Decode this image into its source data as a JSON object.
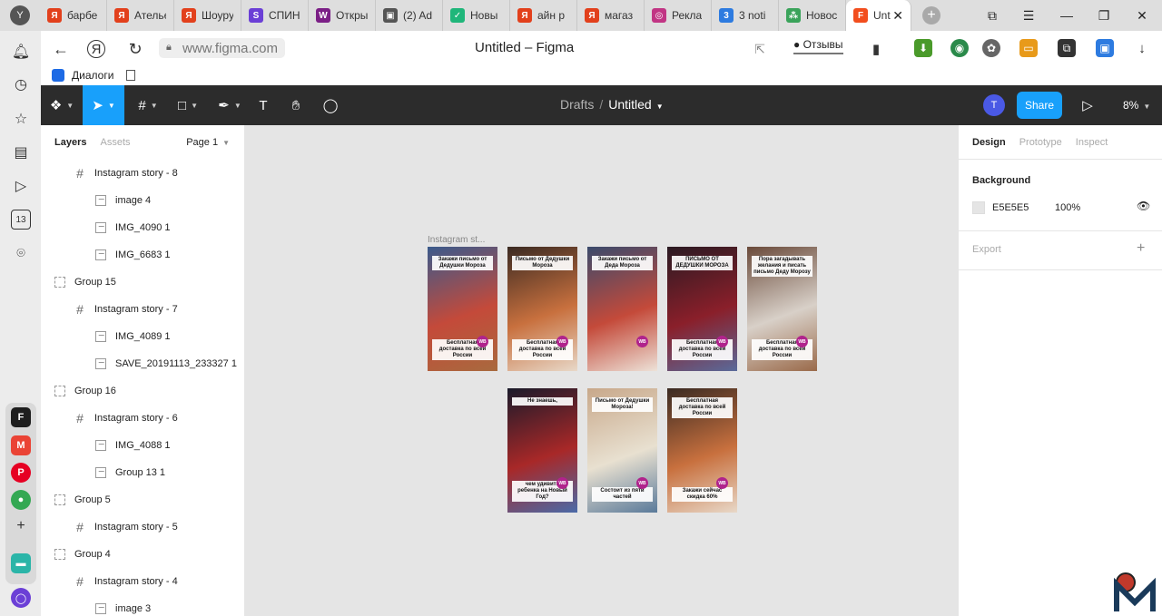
{
  "browser": {
    "logo": "Y",
    "tabs": [
      {
        "label": "барбе",
        "icon_color": "#e2401c",
        "icon_glyph": "Я"
      },
      {
        "label": "Ателье",
        "icon_color": "#e2401c",
        "icon_glyph": "Я"
      },
      {
        "label": "Шоурум",
        "icon_color": "#e2401c",
        "icon_glyph": "Я"
      },
      {
        "label": "СПИН",
        "icon_color": "#6b3fd6",
        "icon_glyph": "S"
      },
      {
        "label": "Откры",
        "icon_color": "#7b1f86",
        "icon_glyph": "W"
      },
      {
        "label": "(2) Ad",
        "icon_color": "#555555",
        "icon_glyph": "▣"
      },
      {
        "label": "Новы",
        "icon_color": "#1fb67a",
        "icon_glyph": "✓"
      },
      {
        "label": "айн р",
        "icon_color": "#e2401c",
        "icon_glyph": "Я"
      },
      {
        "label": "магаз",
        "icon_color": "#e2401c",
        "icon_glyph": "Я"
      },
      {
        "label": "Рекла",
        "icon_color": "#c13584",
        "icon_glyph": "◎"
      },
      {
        "label": "3 noti",
        "icon_color": "#2d7be0",
        "icon_glyph": "3"
      },
      {
        "label": "Новос",
        "icon_color": "#3aa35a",
        "icon_glyph": "⁂"
      }
    ],
    "active_tab": {
      "label": "Unt",
      "icon_color": "#f24e1e",
      "icon_glyph": "F"
    },
    "url": "www.figma.com",
    "page_title": "Untitled – Figma",
    "reviews_label": "Отзывы",
    "bookmark_label": "Диалоги",
    "sidebar_badge": "13"
  },
  "figma": {
    "breadcrumb_root": "Drafts",
    "breadcrumb_sep": "/",
    "file_name": "Untitled",
    "avatar_letter": "T",
    "share_label": "Share",
    "zoom_label": "8%",
    "layers_tab": "Layers",
    "assets_tab": "Assets",
    "page_label": "Page 1",
    "layers": [
      {
        "name": "Instagram story - 8",
        "type": "frame",
        "indent": 2
      },
      {
        "name": "image 4",
        "type": "image",
        "indent": 3
      },
      {
        "name": "IMG_4090 1",
        "type": "image",
        "indent": 3
      },
      {
        "name": "IMG_6683 1",
        "type": "image",
        "indent": 3
      },
      {
        "name": "Group 15",
        "type": "group",
        "indent": 1
      },
      {
        "name": "Instagram story - 7",
        "type": "frame",
        "indent": 2
      },
      {
        "name": "IMG_4089 1",
        "type": "image",
        "indent": 3
      },
      {
        "name": "SAVE_20191113_233327 1",
        "type": "image",
        "indent": 3
      },
      {
        "name": "Group 16",
        "type": "group",
        "indent": 1
      },
      {
        "name": "Instagram story - 6",
        "type": "frame",
        "indent": 2
      },
      {
        "name": "IMG_4088 1",
        "type": "image",
        "indent": 3
      },
      {
        "name": "Group 13 1",
        "type": "image",
        "indent": 3
      },
      {
        "name": "Group 5",
        "type": "group",
        "indent": 1
      },
      {
        "name": "Instagram story - 5",
        "type": "frame",
        "indent": 2
      },
      {
        "name": "Group 4",
        "type": "group",
        "indent": 1
      },
      {
        "name": "Instagram story - 4",
        "type": "frame",
        "indent": 2
      },
      {
        "name": "image 3",
        "type": "image",
        "indent": 3
      }
    ],
    "canvas_frame_label": "Instagram st...",
    "stories": [
      {
        "top_text": "Закажи письмо от Дедушки Мороза",
        "bottom_text": "Бесплатная доставка по всей России",
        "colors": [
          "#3a5a8c",
          "#c44a3a",
          "#a86a3e"
        ]
      },
      {
        "top_text": "Письмо от Дедушки Мороза",
        "bottom_text": "Бесплатная доставка по всей России",
        "colors": [
          "#3b2a22",
          "#c8703e",
          "#e8d8c8"
        ]
      },
      {
        "top_text": "Закажи письмо от Деда Мороза",
        "bottom_text": "",
        "colors": [
          "#3a4a6c",
          "#c44a3a",
          "#ede2d8"
        ]
      },
      {
        "top_text": "ПИСЬМО ОТ ДЕДУШКИ МОРОЗА",
        "bottom_text": "Бесплатная доставка по всей России",
        "colors": [
          "#2a1a22",
          "#8a1f2a",
          "#5a6a9a"
        ]
      },
      {
        "top_text": "Пора загадывать желания и писать письмо Деду Морозу",
        "bottom_text": "Бесплатная доставка по всей России",
        "colors": [
          "#6a4a3a",
          "#d8d0c8",
          "#9a6a4a"
        ]
      },
      {
        "top_text": "Не знаешь,",
        "bottom_text": "чем удивить ребенка на Новый Год?",
        "colors": [
          "#1a1a2a",
          "#a82828",
          "#4a6aa8"
        ]
      },
      {
        "top_text": "Письмо от Дедушки Мороза!",
        "bottom_text": "Состоит из пяти частей",
        "colors": [
          "#c8a88a",
          "#e8e0d0",
          "#5a7a9a"
        ]
      },
      {
        "top_text": "Бесплатная доставка по всей России",
        "bottom_text": "Закажи сейчас скидка 60%",
        "colors": [
          "#3a2a22",
          "#c8703e",
          "#e8d8c8"
        ]
      }
    ],
    "wb_label": "WB",
    "right_tabs": [
      "Design",
      "Prototype",
      "Inspect"
    ],
    "background_title": "Background",
    "bg_hex": "E5E5E5",
    "bg_opacity": "100%",
    "export_title": "Export"
  }
}
